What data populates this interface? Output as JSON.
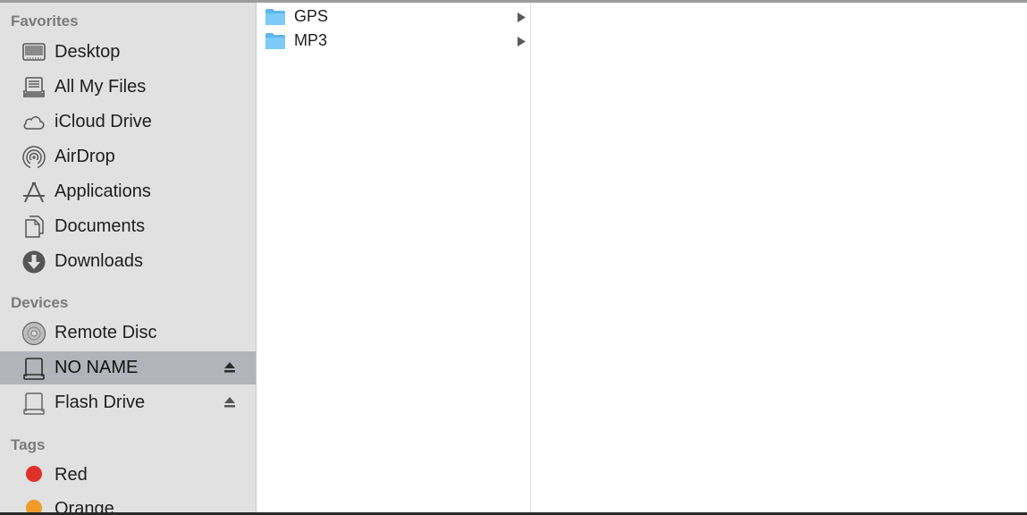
{
  "sidebar": {
    "favorites_header": "Favorites",
    "favorites": [
      {
        "label": "Desktop",
        "icon": "desktop-icon"
      },
      {
        "label": "All My Files",
        "icon": "all-files-icon"
      },
      {
        "label": "iCloud Drive",
        "icon": "cloud-icon"
      },
      {
        "label": "AirDrop",
        "icon": "airdrop-icon"
      },
      {
        "label": "Applications",
        "icon": "applications-icon"
      },
      {
        "label": "Documents",
        "icon": "documents-icon"
      },
      {
        "label": "Downloads",
        "icon": "downloads-icon"
      }
    ],
    "devices_header": "Devices",
    "devices": [
      {
        "label": "Remote Disc",
        "icon": "disc-icon"
      },
      {
        "label": "NO NAME",
        "icon": "drive-icon",
        "selected": true,
        "ejectable": true
      },
      {
        "label": "Flash Drive",
        "icon": "drive-icon",
        "ejectable": true
      }
    ],
    "tags_header": "Tags",
    "tags": [
      {
        "label": "Red",
        "color": "#e0302a"
      },
      {
        "label": "Orange",
        "color": "#f09a27"
      }
    ]
  },
  "column1": {
    "items": [
      {
        "name": "GPS",
        "type": "folder"
      },
      {
        "name": "MP3",
        "type": "folder"
      }
    ]
  },
  "colors": {
    "sidebar_bg": "#e1e1e1",
    "selection_bg": "#b1b4b9",
    "folder_blue": "#6cc3f2"
  }
}
